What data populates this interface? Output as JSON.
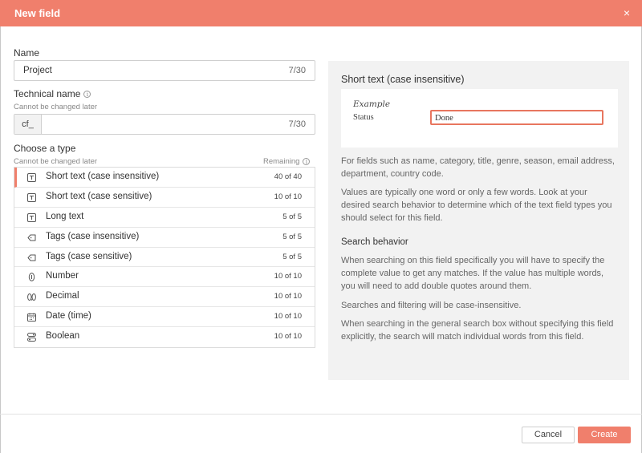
{
  "dialog": {
    "title": "New field",
    "close_glyph": "×"
  },
  "name": {
    "label": "Name",
    "value": "Project",
    "count": "7/30"
  },
  "technical_name": {
    "label": "Technical name",
    "sublabel": "Cannot be changed later",
    "prefix": "cf_",
    "value": "",
    "count": "7/30",
    "info_glyph": "i"
  },
  "type": {
    "label": "Choose a type",
    "sublabel": "Cannot be changed later",
    "remaining_label": "Remaining",
    "options": [
      {
        "label": "Short text (case insensitive)",
        "count": "40 of 40",
        "icon": "text-icon",
        "selected": true
      },
      {
        "label": "Short text (case sensitive)",
        "count": "10 of 10",
        "icon": "text-icon"
      },
      {
        "label": "Long text",
        "count": "5 of 5",
        "icon": "text-icon"
      },
      {
        "label": "Tags (case insensitive)",
        "count": "5 of 5",
        "icon": "tag-icon"
      },
      {
        "label": "Tags (case sensitive)",
        "count": "5 of 5",
        "icon": "tag-icon"
      },
      {
        "label": "Number",
        "count": "10 of 10",
        "icon": "number-icon"
      },
      {
        "label": "Decimal",
        "count": "10 of 10",
        "icon": "decimal-icon"
      },
      {
        "label": "Date (time)",
        "count": "10 of 10",
        "icon": "calendar-icon"
      },
      {
        "label": "Boolean",
        "count": "10 of 10",
        "icon": "toggle-icon"
      }
    ]
  },
  "panel": {
    "title": "Short text (case insensitive)",
    "example_label": "Example",
    "example_field_label": "Status",
    "example_value": "Done",
    "desc1": "For fields such as name, category, title, genre, season, email address, department, country code.",
    "desc2": "Values are typically one word or only a few words. Look at your desired search behavior to determine which of the text field types you should select for this field.",
    "search_title": "Search behavior",
    "search1": "When searching on this field specifically you will have to specify the complete value to get any matches. If the value has multiple words, you will need to add double quotes around them.",
    "search2": "Searches and filtering will be case-insensitive.",
    "search3": "When searching in the general search box without specifying this field explicitly, the search will match individual words from this field."
  },
  "footer": {
    "cancel": "Cancel",
    "create": "Create"
  },
  "colors": {
    "accent": "#f07f6c",
    "panel_bg": "#f2f2f2"
  }
}
